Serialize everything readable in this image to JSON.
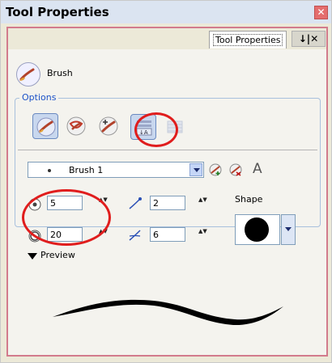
{
  "window": {
    "title": "Tool Properties",
    "close_icon": "close-icon"
  },
  "tab": {
    "label": "Tool Properties",
    "menu_glyph": "↓|✕"
  },
  "tool": {
    "name": "Brush",
    "icon": "brush-icon"
  },
  "options": {
    "legend": "Options",
    "mode_buttons": [
      {
        "icon": "brush-mode-icon",
        "selected": true
      },
      {
        "icon": "repaint-brush-icon",
        "selected": false
      },
      {
        "icon": "add-brush-icon",
        "selected": false
      },
      {
        "icon": "auto-flatten-icon",
        "selected": true
      },
      {
        "icon": "texture-icon",
        "selected": false
      }
    ]
  },
  "preset": {
    "value": "Brush 1",
    "new_preset_icon": "new-preset-icon",
    "delete_preset_icon": "delete-preset-icon",
    "font_icon": "A"
  },
  "params": {
    "min_size": "5",
    "max_size": "20",
    "smoothness": "2",
    "contour_smoothness": "6",
    "spin_glyph": "▲▼"
  },
  "shape": {
    "label": "Shape",
    "value": "circle"
  },
  "preview": {
    "label": "Preview"
  },
  "colors": {
    "accent_border": "#d27b8c",
    "highlight_ring": "#e01d1d",
    "legend_blue": "#1c52c8"
  }
}
